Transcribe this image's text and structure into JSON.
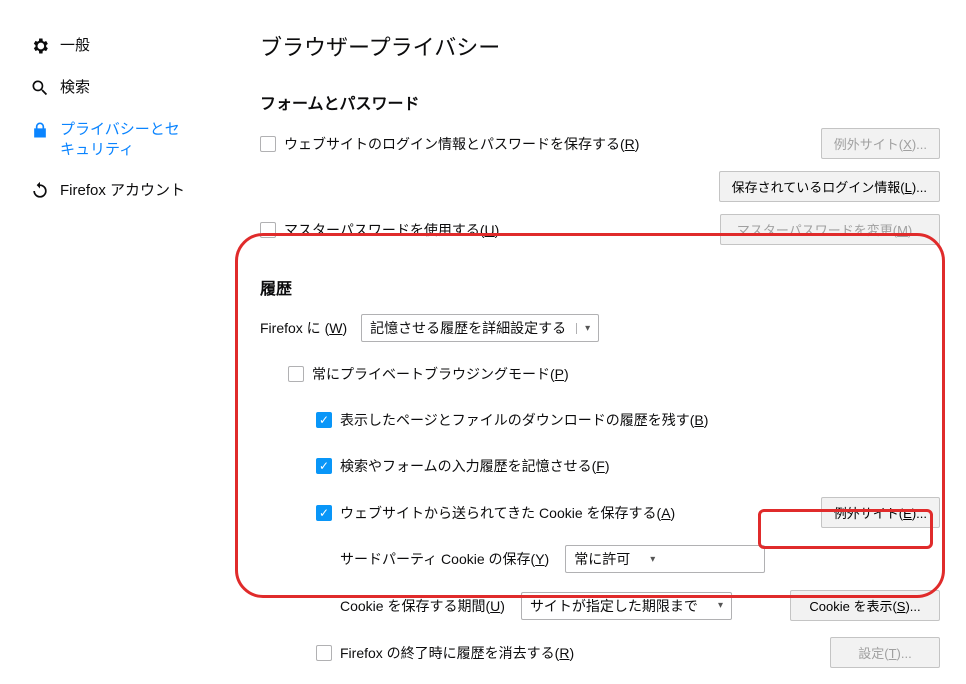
{
  "sidebar": {
    "items": [
      {
        "label": "一般"
      },
      {
        "label": "検索"
      },
      {
        "label": "プライバシーとセキュリティ"
      },
      {
        "label": "Firefox アカウント"
      }
    ]
  },
  "page": {
    "title": "ブラウザープライバシー"
  },
  "forms": {
    "title": "フォームとパスワード",
    "save_logins_label": "ウェブサイトのログイン情報とパスワードを保存する(",
    "save_logins_key": "R",
    "exceptions_btn": "例外サイト(",
    "exceptions_key": "X",
    "saved_logins_btn": "保存されているログイン情報(",
    "saved_logins_key": "L",
    "master_pw_label": "マスターパスワードを使用する(",
    "master_pw_key": "U",
    "change_master_btn": "マスターパスワードを変更(",
    "change_master_key": "M"
  },
  "history": {
    "title": "履歴",
    "firefox_will_pre": "Firefox に (",
    "firefox_will_key": "W",
    "mode_select": "記憶させる履歴を詳細設定する",
    "always_private_label": "常にプライベートブラウジングモード(",
    "always_private_key": "P",
    "remember_visits_label": "表示したページとファイルのダウンロードの履歴を残す(",
    "remember_visits_key": "B",
    "remember_search_label": "検索やフォームの入力履歴を記憶させる(",
    "remember_search_key": "F",
    "accept_cookies_label": "ウェブサイトから送られてきた Cookie を保存する(",
    "accept_cookies_key": "A",
    "exceptions_btn": "例外サイト(",
    "exceptions_key": "E",
    "third_party_label": "サードパーティ Cookie の保存(",
    "third_party_key": "Y",
    "third_party_value": "常に許可",
    "keep_until_label": "Cookie を保存する期間(",
    "keep_until_key": "U",
    "keep_until_value": "サイトが指定した期限まで",
    "show_cookies_btn": "Cookie を表示(",
    "show_cookies_key": "S",
    "clear_on_close_label": "Firefox の終了時に履歴を消去する(",
    "clear_on_close_key": "R",
    "settings_btn": "設定(",
    "settings_key": "T"
  },
  "close_paren": ")",
  "ellipsis": "..."
}
